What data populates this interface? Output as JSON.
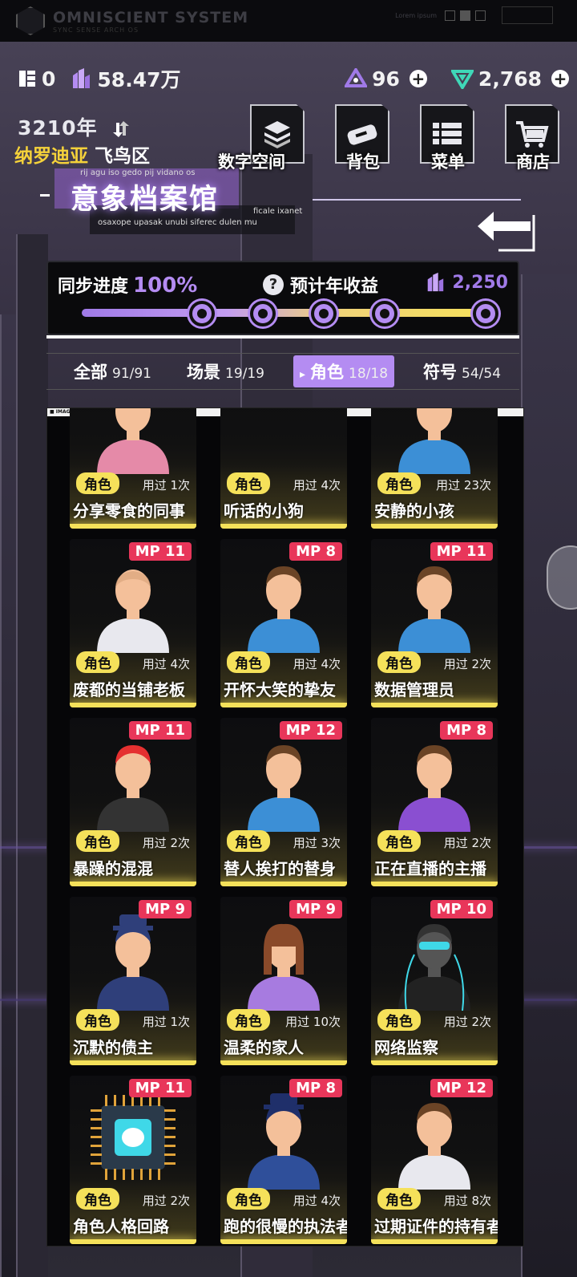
{
  "system": {
    "title": "OMNISCIENT SYSTEM",
    "subtitle": "SYNC SENSE ARCH OS",
    "lorem": "Lorem ipsum"
  },
  "resources": {
    "chips": "0",
    "crystals": "58.47万",
    "tickets": "96",
    "gems": "2,768"
  },
  "location": {
    "year": "3210年",
    "city": "纳罗迪亚",
    "district": "飞鸟区"
  },
  "deco_text": {
    "line1": "rij agu iso gedo pij vidano os",
    "line2": "ficale ixanet",
    "line3": "osaxope upasak unubi siferec dulen mu"
  },
  "page_title": "意象档案馆",
  "nav": [
    {
      "label": "数字空间",
      "icon": "layers-icon"
    },
    {
      "label": "背包",
      "icon": "bag-icon"
    },
    {
      "label": "菜单",
      "icon": "menu-icon"
    },
    {
      "label": "商店",
      "icon": "cart-icon"
    }
  ],
  "progress": {
    "sync_label": "同步进度",
    "sync_value": "100%",
    "sync_fraction": 1.0,
    "yield_label": "预计年收益",
    "yield_value": "2,250",
    "nodes": 5
  },
  "tabs": [
    {
      "label": "全部",
      "count": "91/91",
      "active": false
    },
    {
      "label": "场景",
      "count": "19/19",
      "active": false
    },
    {
      "label": "角色",
      "count": "18/18",
      "active": true
    },
    {
      "label": "符号",
      "count": "54/54",
      "active": false
    }
  ],
  "grid_header": "IMAGERY COMPONENT",
  "cards": [
    {
      "name": "分享零食的同事",
      "role": "角色",
      "used": "用过 1次",
      "mp": ""
    },
    {
      "name": "听话的小狗",
      "role": "角色",
      "used": "用过 4次",
      "mp": ""
    },
    {
      "name": "安静的小孩",
      "role": "角色",
      "used": "用过 23次",
      "mp": ""
    },
    {
      "name": "废都的当铺老板",
      "role": "角色",
      "used": "用过 4次",
      "mp": "MP 11"
    },
    {
      "name": "开怀大笑的挚友",
      "role": "角色",
      "used": "用过 4次",
      "mp": "MP 8"
    },
    {
      "name": "数据管理员",
      "role": "角色",
      "used": "用过 2次",
      "mp": "MP 11"
    },
    {
      "name": "暴躁的混混",
      "role": "角色",
      "used": "用过 2次",
      "mp": "MP 11"
    },
    {
      "name": "替人挨打的替身",
      "role": "角色",
      "used": "用过 3次",
      "mp": "MP 12"
    },
    {
      "name": "正在直播的主播",
      "role": "角色",
      "used": "用过 2次",
      "mp": "MP 8"
    },
    {
      "name": "沉默的债主",
      "role": "角色",
      "used": "用过 1次",
      "mp": "MP 9"
    },
    {
      "name": "温柔的家人",
      "role": "角色",
      "used": "用过 10次",
      "mp": "MP 9"
    },
    {
      "name": "网络监察",
      "role": "角色",
      "used": "用过 2次",
      "mp": "MP 10"
    },
    {
      "name": "角色人格回路",
      "role": "角色",
      "used": "用过 2次",
      "mp": "MP 11"
    },
    {
      "name": "跑的很慢的执法者",
      "role": "角色",
      "used": "用过 4次",
      "mp": "MP 8"
    },
    {
      "name": "过期证件的持有者",
      "role": "角色",
      "used": "用过 8次",
      "mp": "MP 12"
    }
  ],
  "colors": {
    "accent_purple": "#b48cf2",
    "accent_yellow": "#f5e15a",
    "mp_red": "#e8365a"
  }
}
